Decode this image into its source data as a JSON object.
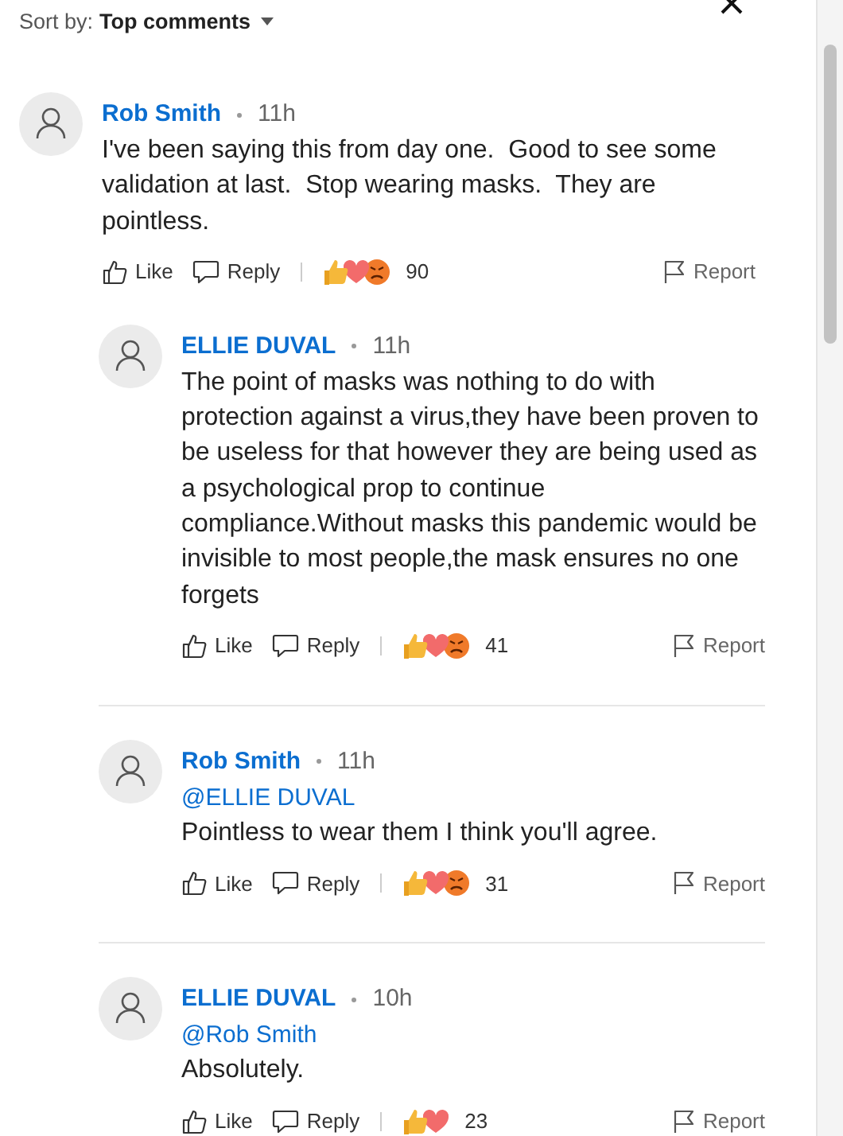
{
  "sort": {
    "label": "Sort by:",
    "value": "Top comments"
  },
  "comments": [
    {
      "author": "Rob Smith",
      "time": "11h",
      "reply": false,
      "text": "I've been saying this from day one.  Good to see some validation at last.  Stop wearing masks.  They are pointless.",
      "actions": {
        "like": "Like",
        "reply": "Reply",
        "report": "Report"
      },
      "reactions": [
        {
          "kind": "like"
        },
        {
          "kind": "heart"
        },
        {
          "kind": "angry"
        }
      ],
      "count": "90"
    },
    {
      "author": "ELLIE DUVAL",
      "time": "11h",
      "reply": true,
      "text": "The point of masks was nothing to do with protection against a virus,they have been proven to be useless for that however they are being used as a psychological prop to continue compliance.Without masks this pandemic would be invisible to most people,the mask ensures no one forgets",
      "actions": {
        "like": "Like",
        "reply": "Reply",
        "report": "Report"
      },
      "reactions": [
        {
          "kind": "like"
        },
        {
          "kind": "heart"
        },
        {
          "kind": "angry"
        }
      ],
      "count": "41"
    },
    {
      "author": "Rob Smith",
      "time": "11h",
      "reply": true,
      "mention": "@ELLIE DUVAL",
      "text": "Pointless to wear them I think you'll agree.",
      "actions": {
        "like": "Like",
        "reply": "Reply",
        "report": "Report"
      },
      "reactions": [
        {
          "kind": "like"
        },
        {
          "kind": "heart"
        },
        {
          "kind": "angry"
        }
      ],
      "count": "31"
    },
    {
      "author": "ELLIE DUVAL",
      "time": "10h",
      "reply": true,
      "mention": "@Rob Smith",
      "text": "Absolutely.",
      "actions": {
        "like": "Like",
        "reply": "Reply",
        "report": "Report"
      },
      "reactions": [
        {
          "kind": "like"
        },
        {
          "kind": "heart"
        }
      ],
      "count": "23"
    }
  ]
}
